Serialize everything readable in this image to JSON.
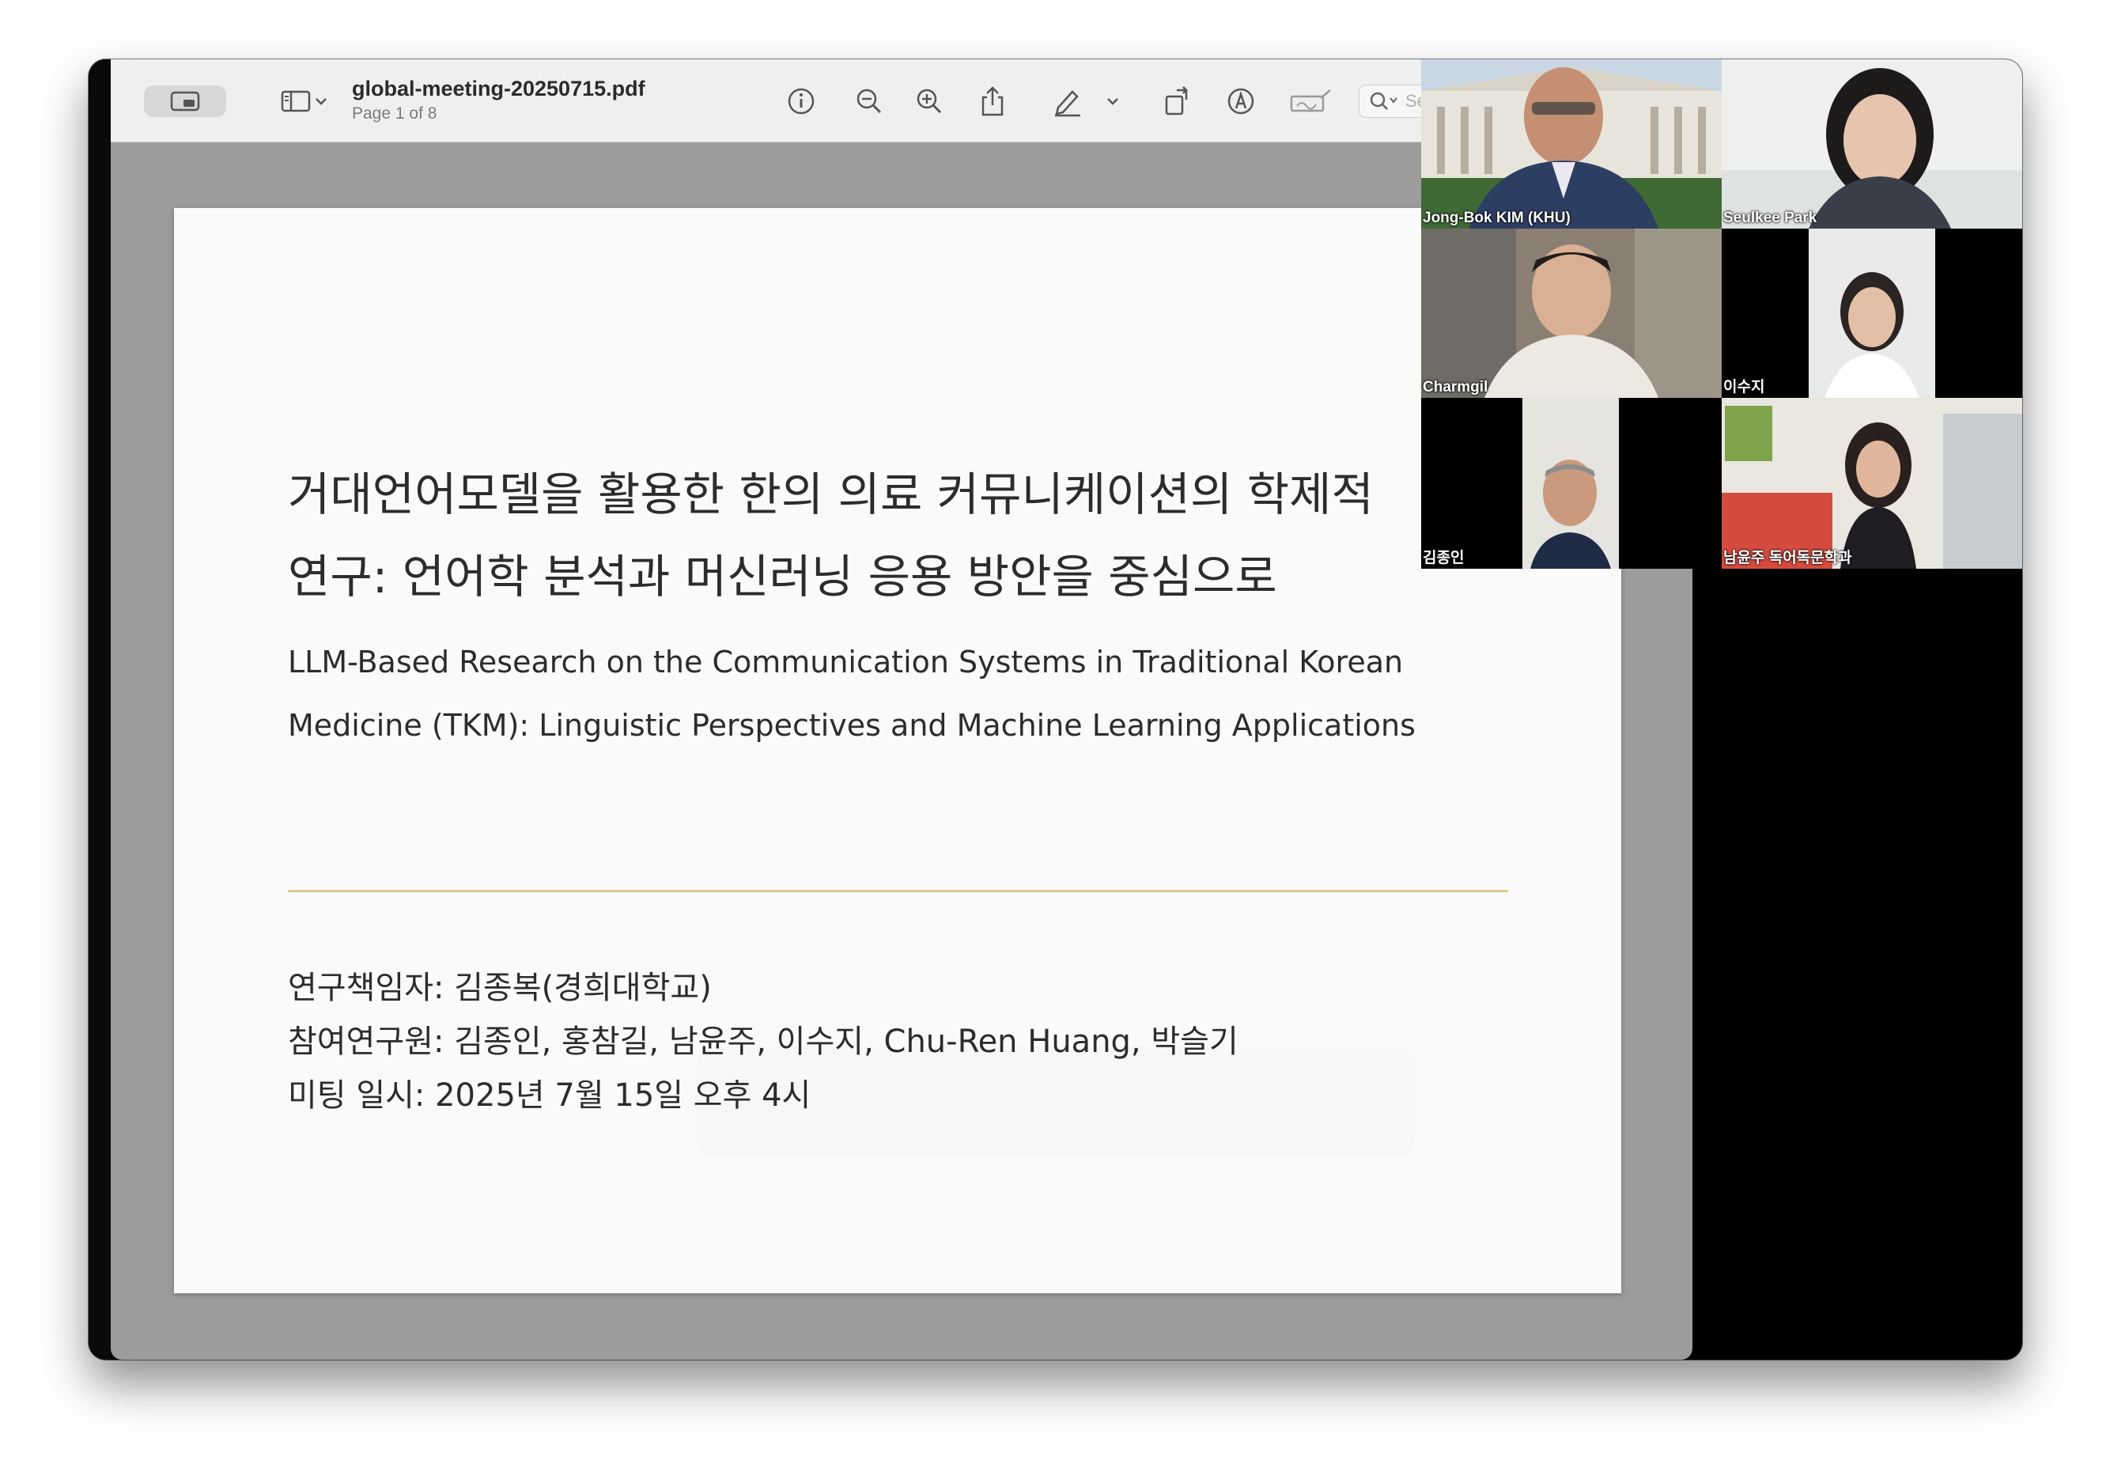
{
  "toolbar": {
    "document_title": "global-meeting-20250715.pdf",
    "page_info": "Page 1 of 8",
    "search_placeholder": "Se",
    "icons": [
      "sidebar-toggle-icon",
      "sidebar-layout-icon",
      "chevron-down-icon",
      "info-icon",
      "zoom-out-icon",
      "zoom-in-icon",
      "share-icon",
      "highlight-pen-icon",
      "chevron-down-icon",
      "rotate-icon",
      "markup-icon",
      "signature-icon",
      "search-icon"
    ]
  },
  "slide": {
    "title_ko_line1": "거대언어모델을 활용한 한의 의료 커뮤니케이션의 학제적",
    "title_ko_line2": "연구: 언어학 분석과 머신러닝 응용 방안을 중심으로",
    "title_en_line1": "LLM-Based Research on the Communication Systems in Traditional Korean",
    "title_en_line2": "Medicine (TKM): Linguistic Perspectives and Machine Learning Applications",
    "principal_investigator": "연구책임자: 김종복(경희대학교)",
    "researchers": "참여연구원: 김종인, 홍참길, 남윤주, 이수지, Chu-Ren Huang, 박슬기",
    "meeting_time": "미팅 일시: 2025년 7월 15일 오후 4시",
    "accent_color": "#e3c790"
  },
  "participants": [
    {
      "name": "Jong-Bok KIM (KHU)"
    },
    {
      "name": "Seulkee Park"
    },
    {
      "name": "Charmgil"
    },
    {
      "name": "이수지"
    },
    {
      "name": "김종인"
    },
    {
      "name": "남윤주 독어독문학과"
    }
  ]
}
